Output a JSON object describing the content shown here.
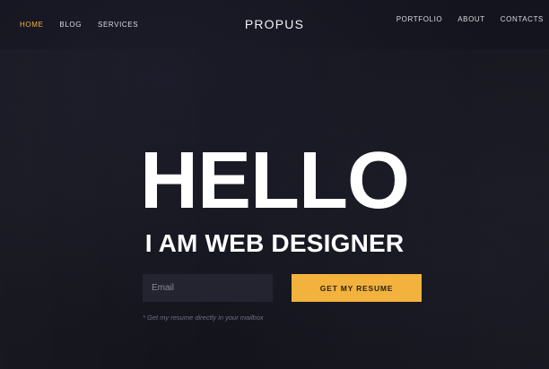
{
  "nav": {
    "left": [
      {
        "label": "HOME",
        "active": true
      },
      {
        "label": "BLOG",
        "active": false
      },
      {
        "label": "SERVICES",
        "active": false
      }
    ],
    "right": [
      {
        "label": "PORTFOLIO"
      },
      {
        "label": "ABOUT"
      },
      {
        "label": "CONTACTS"
      }
    ],
    "logo": "PROPUS"
  },
  "hero": {
    "headline": "HELLO",
    "subheadline": "I AM WEB DESIGNER",
    "email_placeholder": "Email",
    "cta_label": "GET MY RESUME",
    "note": "* Get my resume directly in your mailbox"
  },
  "colors": {
    "accent": "#f2b23d",
    "background": "#15141f"
  }
}
